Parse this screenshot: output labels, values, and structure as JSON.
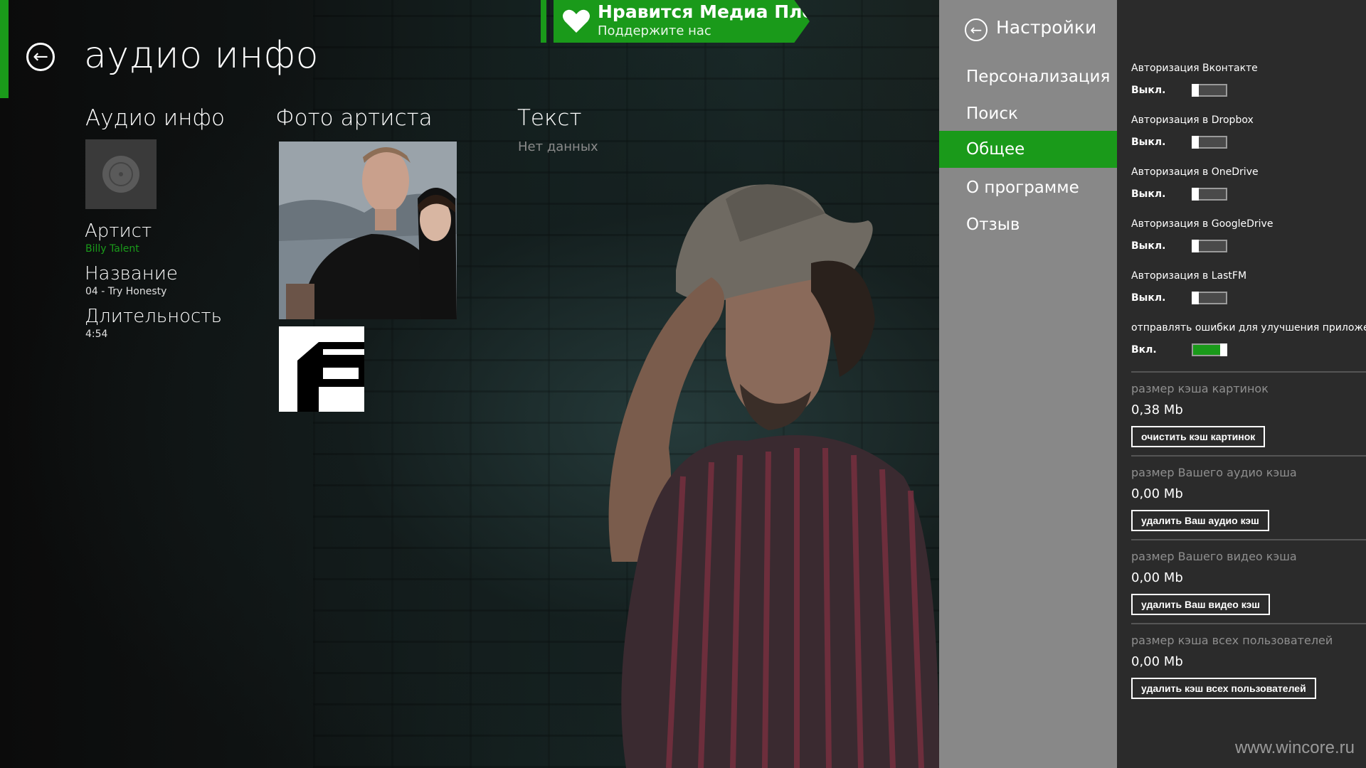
{
  "header": {
    "title": "аудио инфо"
  },
  "banner": {
    "title": "Нравится Медиа Плеер?",
    "subtitle": "Поддержите нас"
  },
  "audio_info": {
    "section_title": "Аудио инфо",
    "artist_label": "Артист",
    "artist_value": "Billy Talent",
    "title_label": "Название",
    "title_value": "04 - Try Honesty",
    "duration_label": "Длительность",
    "duration_value": "4:54"
  },
  "artist_photo": {
    "section_title": "Фото артиста"
  },
  "lyrics": {
    "section_title": "Текст",
    "empty_text": "Нет данных"
  },
  "settings_nav": {
    "title": "Настройки",
    "items": [
      {
        "label": "Персонализация",
        "active": false
      },
      {
        "label": "Поиск",
        "active": false
      },
      {
        "label": "Общее",
        "active": true
      },
      {
        "label": "О программе",
        "active": false
      },
      {
        "label": "Отзыв",
        "active": false
      }
    ]
  },
  "settings": {
    "toggles": [
      {
        "label": "Авторизация Вконтакте",
        "state": "Выкл.",
        "on": false
      },
      {
        "label": "Авторизация в Dropbox",
        "state": "Выкл.",
        "on": false
      },
      {
        "label": "Авторизация в OneDrive",
        "state": "Выкл.",
        "on": false
      },
      {
        "label": "Авторизация в GoogleDrive",
        "state": "Выкл.",
        "on": false
      },
      {
        "label": "Авторизация в LastFM",
        "state": "Выкл.",
        "on": false
      },
      {
        "label": "отправлять ошибки для улучшения приложения",
        "state": "Вкл.",
        "on": true
      }
    ],
    "caches": [
      {
        "title": "размер кэша картинок",
        "value": "0,38 Mb",
        "button": "очистить кэш картинок"
      },
      {
        "title": "размер Вашего аудио кэша",
        "value": "0,00 Mb",
        "button": "удалить Ваш аудио кэш"
      },
      {
        "title": "размер Вашего видео кэша",
        "value": "0,00 Mb",
        "button": "удалить Ваш видео кэш"
      },
      {
        "title": "размер кэша всех пользователей",
        "value": "0,00 Mb",
        "button": "удалить кэш всех пользователей"
      }
    ]
  },
  "watermark": "www.wincore.ru",
  "colors": {
    "accent": "#1a9a1a",
    "nav_bg": "#888888",
    "panel_bg": "#2b2b2b"
  }
}
